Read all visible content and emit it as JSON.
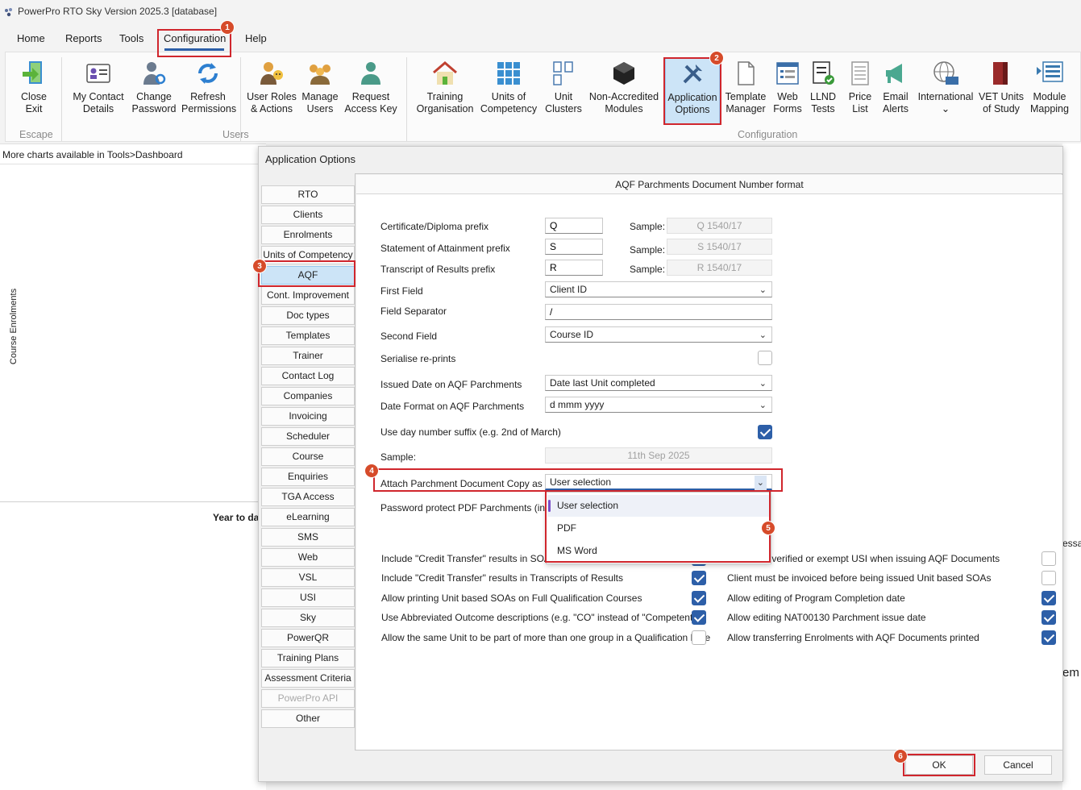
{
  "window": {
    "title": "PowerPro RTO Sky Version 2025.3 [database]"
  },
  "menu": {
    "items": [
      "Home",
      "Reports",
      "Tools",
      "Configuration",
      "Help"
    ]
  },
  "ribbon": {
    "buttons": [
      {
        "line1": "Close",
        "line2": "Exit",
        "icon": "exit-door-icon"
      },
      {
        "line1": "My Contact",
        "line2": "Details",
        "icon": "contact-card-icon"
      },
      {
        "line1": "Change",
        "line2": "Password",
        "icon": "user-key-icon"
      },
      {
        "line1": "Refresh",
        "line2": "Permissions",
        "icon": "refresh-icon"
      },
      {
        "line1": "User Roles",
        "line2": "& Actions",
        "icon": "user-roles-icon"
      },
      {
        "line1": "Manage",
        "line2": "Users",
        "icon": "users-group-icon"
      },
      {
        "line1": "Request",
        "line2": "Access Key",
        "icon": "user-icon"
      },
      {
        "line1": "Training",
        "line2": "Organisation",
        "icon": "house-icon"
      },
      {
        "line1": "Units of",
        "line2": "Competency",
        "icon": "grid-icon"
      },
      {
        "line1": "Unit",
        "line2": "Clusters",
        "icon": "clusters-icon"
      },
      {
        "line1": "Non-Accredited",
        "line2": "Modules",
        "icon": "cube-icon"
      },
      {
        "line1": "Application",
        "line2": "Options",
        "icon": "tools-icon"
      },
      {
        "line1": "Template",
        "line2": "Manager",
        "icon": "document-icon"
      },
      {
        "line1": "Web",
        "line2": "Forms",
        "icon": "web-form-icon"
      },
      {
        "line1": "LLND",
        "line2": "Tests",
        "icon": "checklist-icon"
      },
      {
        "line1": "Price",
        "line2": "List",
        "icon": "price-list-icon"
      },
      {
        "line1": "Email",
        "line2": "Alerts",
        "icon": "megaphone-icon"
      },
      {
        "line1": "International",
        "line2": "⌄",
        "icon": "globe-icon"
      },
      {
        "line1": "VET Units",
        "line2": "of Study",
        "icon": "books-icon"
      },
      {
        "line1": "Module",
        "line2": "Mapping",
        "icon": "mapping-icon"
      }
    ],
    "groups": [
      "Escape",
      "Users",
      "Configuration"
    ]
  },
  "background": {
    "charts_note": "More charts available in Tools>Dashboard",
    "axis_label": "Course Enrolments",
    "year_label": "Year to da",
    "right_snip1": "essag",
    "right_snip2": "em"
  },
  "dialog": {
    "title": "Application Options",
    "nav": [
      "RTO",
      "Clients",
      "Enrolments",
      "Units of Competency",
      "AQF",
      "Cont. Improvement",
      "Doc types",
      "Templates",
      "Trainer",
      "Contact Log",
      "Companies",
      "Invoicing",
      "Scheduler",
      "Course",
      "Enquiries",
      "TGA Access",
      "eLearning",
      "SMS",
      "Web",
      "VSL",
      "USI",
      "Sky",
      "PowerQR",
      "Training Plans",
      "Assessment Criteria",
      "PowerPro API",
      "Other"
    ],
    "section_title": "AQF Parchments Document Number format",
    "fields": {
      "cert_label": "Certificate/Diploma prefix",
      "cert_value": "Q",
      "soa_label": "Statement of Attainment prefix",
      "soa_value": "S",
      "tor_label": "Transcript of Results prefix",
      "tor_value": "R",
      "sample_label": "Sample:",
      "sample1": "Q 1540/17",
      "sample2": "S 1540/17",
      "sample3": "R 1540/17",
      "first_field_label": "First Field",
      "first_field_value": "Client ID",
      "separator_label": "Field Separator",
      "separator_value": "/",
      "second_field_label": "Second Field",
      "second_field_value": "Course ID",
      "serialise_label": "Serialise re-prints",
      "issued_label": "Issued Date on AQF Parchments",
      "issued_value": "Date last Unit completed",
      "dateformat_label": "Date Format on AQF Parchments",
      "dateformat_value": "d mmm yyyy",
      "suffix_label": "Use day number suffix (e.g. 2nd of March)",
      "sample_date_label": "Sample:",
      "sample_date_value": "11th Sep 2025",
      "attach_label": "Attach Parchment Document Copy as",
      "attach_value": "User selection",
      "password_label": "Password protect PDF Parchments (includi"
    },
    "dropdown_options": [
      "User selection",
      "PDF",
      "MS Word"
    ],
    "checks_left": [
      {
        "label": "Include \"Credit Transfer\" results in SOAs (partial completion of Qualification)",
        "checked": true
      },
      {
        "label": "Include \"Credit Transfer\" results in Transcripts of Results",
        "checked": true
      },
      {
        "label": "Allow printing Unit based SOAs on Full Qualification Courses",
        "checked": true
      },
      {
        "label": "Use Abbreviated Outcome descriptions (e.g. \"CO\" instead of \"Competent\")",
        "checked": true
      },
      {
        "label": "Allow the same Unit to be part of more than one group in a Qualification Rule",
        "checked": false
      }
    ],
    "checks_right": [
      {
        "label": "Require a verified or exempt USI when issuing AQF Documents",
        "checked": false
      },
      {
        "label": "Client must be invoiced before being issued Unit based SOAs",
        "checked": false
      },
      {
        "label": "Allow editing of Program Completion date",
        "checked": true
      },
      {
        "label": "Allow editing NAT00130 Parchment issue date",
        "checked": true
      },
      {
        "label": "Allow transferring Enrolments with AQF Documents printed",
        "checked": true
      }
    ],
    "ok_label": "OK",
    "cancel_label": "Cancel"
  },
  "badges": [
    "1",
    "2",
    "3",
    "4",
    "5",
    "6"
  ],
  "colors": {
    "accent": "#2d5fa8",
    "highlight": "#cce4f7",
    "callout": "#d0262d",
    "badge": "#d64b2a"
  }
}
